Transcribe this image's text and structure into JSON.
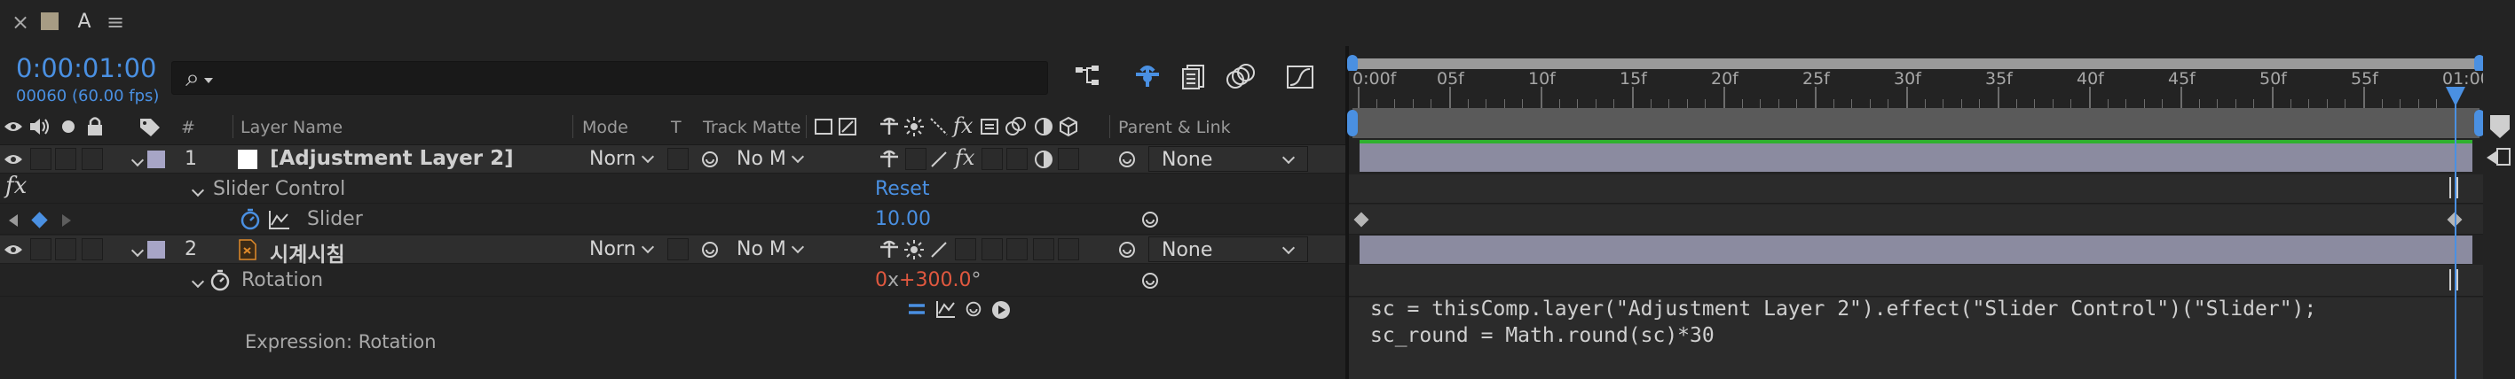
{
  "panel_tab": {
    "close_glyph": "×",
    "lock_glyph": "A",
    "menu_glyph": "≡"
  },
  "time": {
    "current": "0:00:01:00",
    "frames": "00060 (60.00 fps)"
  },
  "search": {
    "icon_glyph": "⌕"
  },
  "columns": {
    "number": "#",
    "layer_name": "Layer Name",
    "mode": "Mode",
    "t": "T",
    "track_matte": "Track Matte",
    "parent": "Parent & Link"
  },
  "ruler": {
    "labels": [
      "0:00f",
      "05f",
      "10f",
      "15f",
      "20f",
      "25f",
      "30f",
      "35f",
      "40f",
      "45f",
      "50f",
      "55f",
      "01:00f"
    ]
  },
  "layers": [
    {
      "number": "1",
      "name": "[Adjustment Layer 2]",
      "mode": "Norn",
      "matte": "No M",
      "parent": "None"
    },
    {
      "number": "2",
      "name": "시계시침",
      "mode": "Norn",
      "matte": "No M",
      "parent": "None"
    }
  ],
  "effect": {
    "fx": "fx",
    "name": "Slider Control",
    "reset": "Reset",
    "slider_label": "Slider",
    "slider_value": "10.00"
  },
  "rotation": {
    "label": "Rotation",
    "turns": "0",
    "x": "x",
    "degrees": "+300.0",
    "unit": "°"
  },
  "expression": {
    "label": "Expression: Rotation",
    "line1": "sc = thisComp.layer(\"Adjustment Layer 2\").effect(\"Slider Control\")(\"Slider\");",
    "line2": "sc_round = Math.round(sc)*30"
  },
  "colors": {
    "accent": "#4a90e2",
    "layer_label": "#a7a5c6",
    "value_red": "#e0583f",
    "work_green": "#2fb12f",
    "bar": "#8b8ba0"
  }
}
